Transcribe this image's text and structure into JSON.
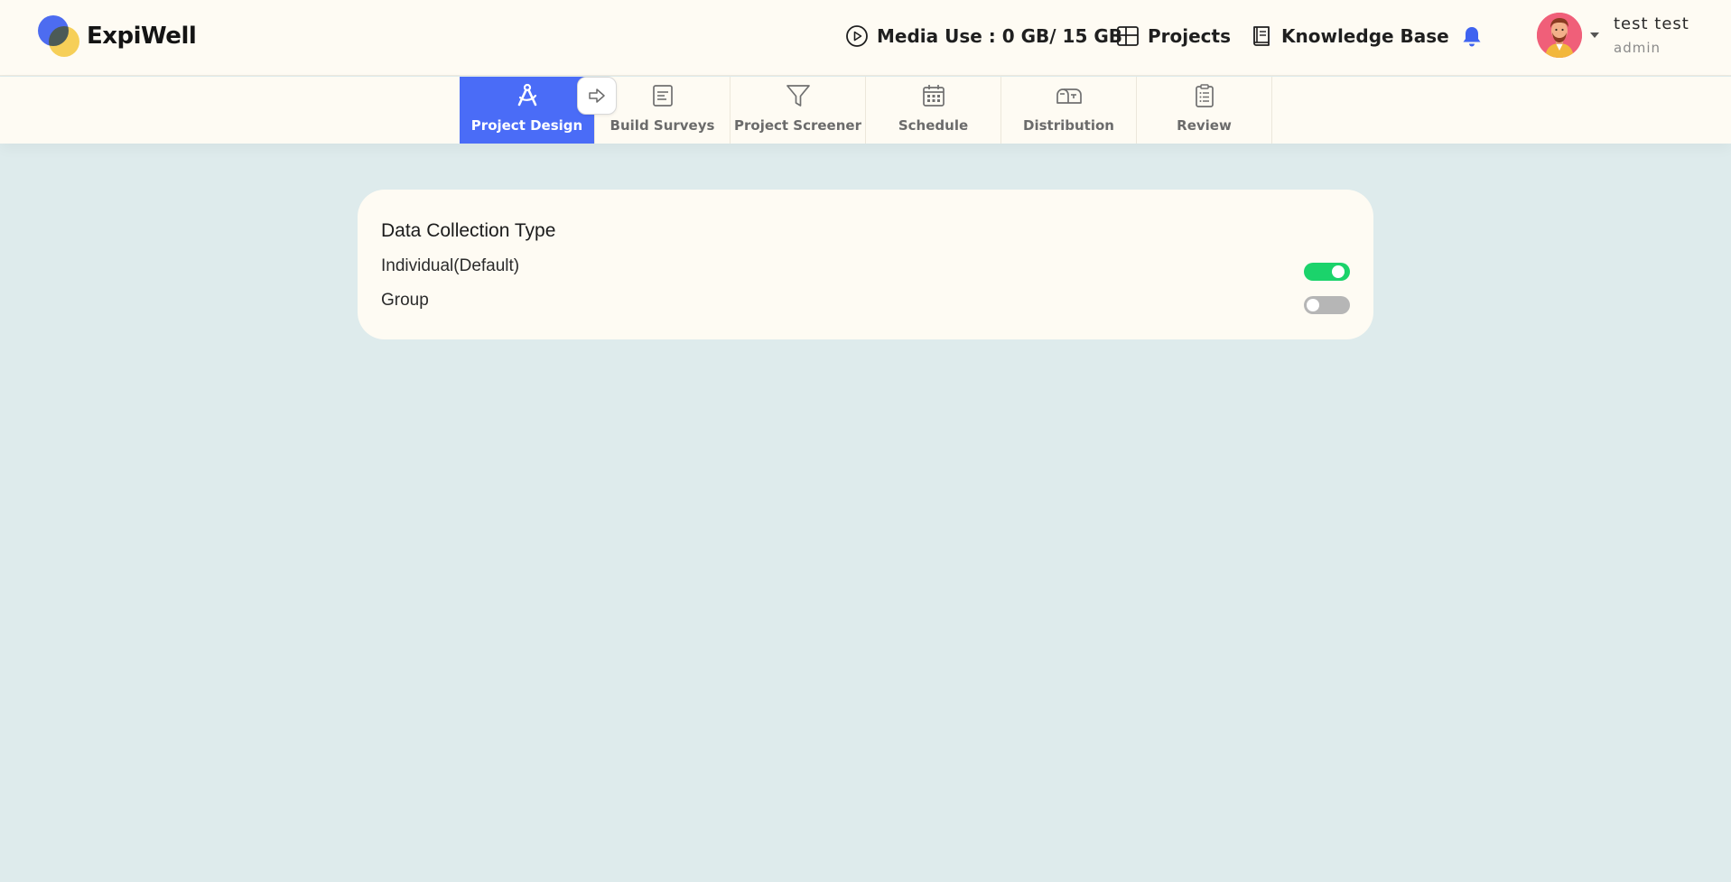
{
  "brand": {
    "name": "ExpiWell"
  },
  "header": {
    "media_use": "Media Use : 0 GB/ 15 GB",
    "projects": "Projects",
    "knowledge_base": "Knowledge Base",
    "user_name": "test test",
    "user_role": "admin"
  },
  "steps": [
    {
      "label": "Project Design",
      "icon": "compass-icon",
      "active": true
    },
    {
      "label": "Build Surveys",
      "icon": "document-icon",
      "active": false
    },
    {
      "label": "Project Screener",
      "icon": "filter-icon",
      "active": false
    },
    {
      "label": "Schedule",
      "icon": "calendar-icon",
      "active": false
    },
    {
      "label": "Distribution",
      "icon": "mailbox-icon",
      "active": false
    },
    {
      "label": "Review",
      "icon": "clipboard-icon",
      "active": false
    }
  ],
  "card": {
    "title": "Data Collection Type",
    "options": [
      {
        "label": "Individual(Default)",
        "enabled": true
      },
      {
        "label": "Group",
        "enabled": false
      }
    ]
  },
  "colors": {
    "accent": "#4a6cf7",
    "toggle_on": "#1bd36b",
    "toggle_off": "#b6b6b6",
    "page_bg": "#deebec",
    "panel_bg": "#fefbf3",
    "bell": "#3f63f0"
  }
}
